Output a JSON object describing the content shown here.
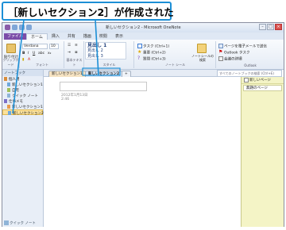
{
  "callout": {
    "text": "［新しいセクション2］が作成された"
  },
  "window": {
    "title": "新しいセクション2 - Microsoft OneNote",
    "controls": {
      "minimize": "–",
      "maximize": "□",
      "close": "×"
    }
  },
  "ribbon_tabs": {
    "file": "ファイル",
    "tabs": [
      "ホーム",
      "挿入",
      "共有",
      "描画",
      "校閲",
      "表示"
    ],
    "active_index": 0
  },
  "ribbon": {
    "clipboard": {
      "paste_label": "貼り付け",
      "label": "クリップボード"
    },
    "font": {
      "font_name": "Verdana",
      "font_size": "10",
      "label": "フォント"
    },
    "basic_text": {
      "label": "基本テキスト"
    },
    "styles": {
      "items": [
        "見出し 1",
        "見出し 2",
        "見出し 3"
      ],
      "label": "スタイル"
    },
    "tags": {
      "items": [
        "タスク (Ctrl+1)",
        "重要 (Ctrl+2)",
        "質問 (Ctrl+3)"
      ],
      "tag_button": "ノートシールの検索",
      "label": "ノート シール"
    },
    "outlook": {
      "items": [
        "ページを電子メールで送信",
        "Outlook タスク",
        "会議の詳細"
      ],
      "label": "Outlook"
    }
  },
  "nav": {
    "header": "ノートブック",
    "items": [
      {
        "label": "個人用",
        "color": "#d98c3a",
        "indent": 0
      },
      {
        "label": "新しいセクション1",
        "color": "#6fa8dc",
        "indent": 4
      },
      {
        "label": "自宅",
        "color": "#a0c05a",
        "indent": 4
      },
      {
        "label": "クイック ノート",
        "color": "#8fb4d8",
        "indent": 4
      },
      {
        "label": "仕事メモ",
        "color": "#7a6fc8",
        "indent": 0
      },
      {
        "label": "新しいセクション1",
        "color": "#e89a4a",
        "indent": 4
      },
      {
        "label": "新しいセクション2",
        "color": "#6fa8dc",
        "indent": 4,
        "selected": true
      }
    ],
    "footer": "クイック ノート"
  },
  "section_tabs": [
    {
      "label": "新しいセクション1",
      "color": "#f6e3c2"
    },
    {
      "label": "新しいセクション2",
      "color": "#d5e4f6",
      "active": true
    },
    {
      "label": "+",
      "color": "#eef2f8"
    }
  ],
  "search": {
    "placeholder": "すべてのノートブックの検索 (Ctrl+E)"
  },
  "page": {
    "date": "2012年1月13日",
    "time": "2:46"
  },
  "page_list": {
    "add_label": "新しいページ",
    "items": [
      "無題のページ"
    ]
  }
}
